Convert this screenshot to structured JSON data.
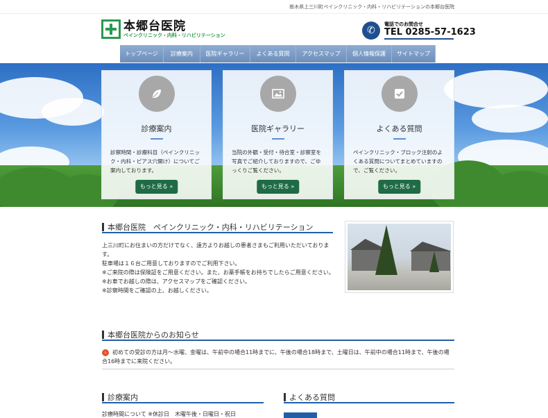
{
  "topbar": {
    "tagline": "栃木県上三川町ペインクリニック・内科・リハビリテーションの本郷台医院"
  },
  "header": {
    "logo_title": "本郷台医院",
    "logo_sub": "ペインクリニック・内科・リハビリテーション",
    "phone_label": "電話でのお問合せ",
    "phone_number": "TEL 0285-57-1623"
  },
  "nav": [
    {
      "label": "トップページ"
    },
    {
      "label": "診療案内"
    },
    {
      "label": "医院ギャラリー"
    },
    {
      "label": "よくある質問"
    },
    {
      "label": "アクセスマップ"
    },
    {
      "label": "個人情報保護"
    },
    {
      "label": "サイトマップ"
    }
  ],
  "cards": [
    {
      "icon": "leaf-icon",
      "title": "診療案内",
      "body": "診察時間・診療科目（ペインクリニック・内科・ピアス穴開け）についてご案内しております。",
      "button": "もっと見る »"
    },
    {
      "icon": "picture-icon",
      "title": "医院ギャラリー",
      "body": "当院の外観・受付・待合室・診察室を写真でご紹介しておりますので、ごゆっくりご覧ください。",
      "button": "もっと見る »"
    },
    {
      "icon": "checkbox-icon",
      "title": "よくある質問",
      "body": "ペインクリニック・ブロック注射のよくある質問についてまとめていますので、ご覧ください。",
      "button": "もっと見る »"
    }
  ],
  "intro": {
    "heading": "本郷台医院　ペインクリニック・内科・リハビリテーション",
    "lines": [
      "上三川町にお住まいの方だけでなく、遠方よりお越しの患者さまもご利用いただいております。",
      "駐車場は１６台ご用意しておりますのでご利用下さい。",
      "※ご来院の際は保険証をご用意ください。また、お薬手帳をお持ちでしたらご用意ください。",
      "※お車でお越しの際は、アクセスマップをご確認ください。",
      "※診察時間をご確認の上、お越しください。"
    ]
  },
  "news": {
    "heading": "本郷台医院からのお知らせ",
    "item": "初めての受診の方は月～水曜、金曜は、午前中の場合11時までに、午後の場合18時まで、土曜日は、午前中の場合11時まで、午後の場合16時までに来院ください。"
  },
  "lower": {
    "left_heading": "診療案内",
    "right_heading": "よくある質問",
    "left_line": "診療時間について ※休診日　木曜午後・日曜日・祝日"
  },
  "colors": {
    "accent": "#1f5fa8",
    "button": "#1f6b45",
    "brand_green": "#2a9a4f",
    "news_arrow": "#e4532b"
  }
}
